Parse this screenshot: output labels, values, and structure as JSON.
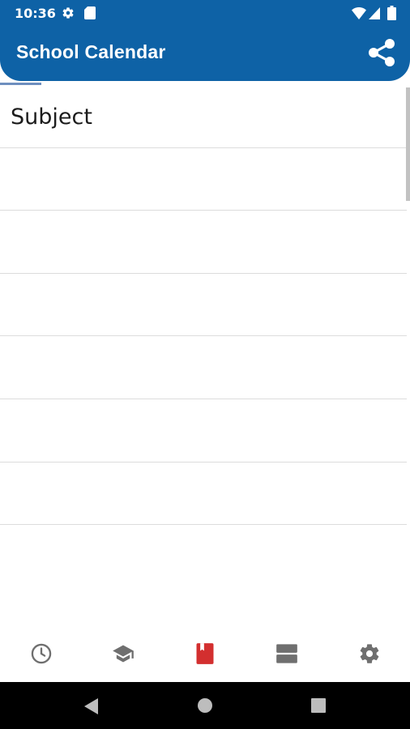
{
  "status_bar": {
    "time": "10:36",
    "icons": [
      "gear-icon",
      "sd-card-icon",
      "wifi-icon",
      "signal-icon",
      "battery-icon"
    ]
  },
  "app_bar": {
    "title": "School Calendar",
    "action_icon": "share-icon",
    "color": "#0e62a6"
  },
  "list": {
    "rows": [
      {
        "label": "Subject"
      },
      {
        "label": ""
      },
      {
        "label": ""
      },
      {
        "label": ""
      },
      {
        "label": ""
      },
      {
        "label": ""
      },
      {
        "label": ""
      },
      {
        "label": ""
      }
    ]
  },
  "bottom_nav": {
    "items": [
      {
        "icon": "clock-icon",
        "active": false
      },
      {
        "icon": "graduation-cap-icon",
        "active": false
      },
      {
        "icon": "book-icon",
        "active": true
      },
      {
        "icon": "view-agenda-icon",
        "active": false
      },
      {
        "icon": "settings-gear-icon",
        "active": false
      }
    ],
    "active_color": "#d32f2f",
    "inactive_color": "#6f6f6f"
  },
  "system_nav": {
    "icons": [
      "back-icon",
      "home-icon",
      "recents-icon"
    ]
  }
}
